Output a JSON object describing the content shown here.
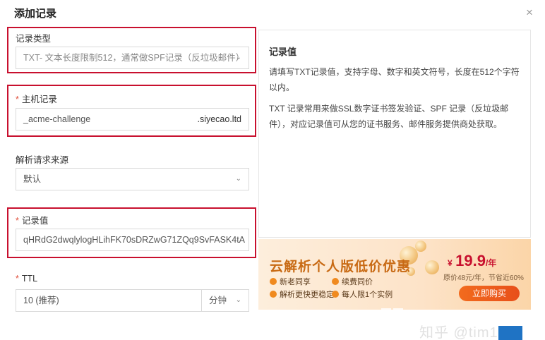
{
  "dialog": {
    "title": "添加记录",
    "close_glyph": "×"
  },
  "form": {
    "record_type": {
      "label": "记录类型",
      "value": "TXT- 文本长度限制512，通常做SPF记录（反垃圾邮件）"
    },
    "host": {
      "required_mark": "*",
      "label": "主机记录",
      "value": "_acme-challenge",
      "suffix": ".siyecao.ltd"
    },
    "source": {
      "label": "解析请求来源",
      "value": "默认"
    },
    "record_value": {
      "required_mark": "*",
      "label": "记录值",
      "value": "qHRdG2dwqlylogHLihFK70sDRZwG71ZQq9SvFASK4tA"
    },
    "ttl": {
      "required_mark": "*",
      "label": "TTL",
      "value": "10 (推荐)",
      "unit": "分钟"
    }
  },
  "help": {
    "title": "记录值",
    "paragraph1": "请填写TXT记录值，支持字母、数字和英文符号，长度在512个字符以内。",
    "paragraph2": "TXT 记录常用来做SSL数字证书签发验证、SPF 记录（反垃圾邮件），对应记录值可从您的证书服务、邮件服务提供商处获取。"
  },
  "banner": {
    "title": "云解析个人版低价优惠",
    "perks": [
      "新老同享",
      "续费同价",
      "解析更快更稳定",
      "每人限1个实例"
    ],
    "price_symbol": "¥",
    "price": "19.9",
    "price_unit": "/年",
    "price_note": "原价48元/年，节省近60%",
    "cta": "立即购买"
  },
  "watermark": "知乎 @tim1991",
  "icons": {
    "close": "close-icon",
    "dropdown": "chevron-down-icon",
    "perk": "check-circle-icon"
  },
  "colors": {
    "highlight": "#c8102e",
    "required": "#e0503c",
    "banner_accent": "#c86a14",
    "cta": "#f26b1d"
  }
}
